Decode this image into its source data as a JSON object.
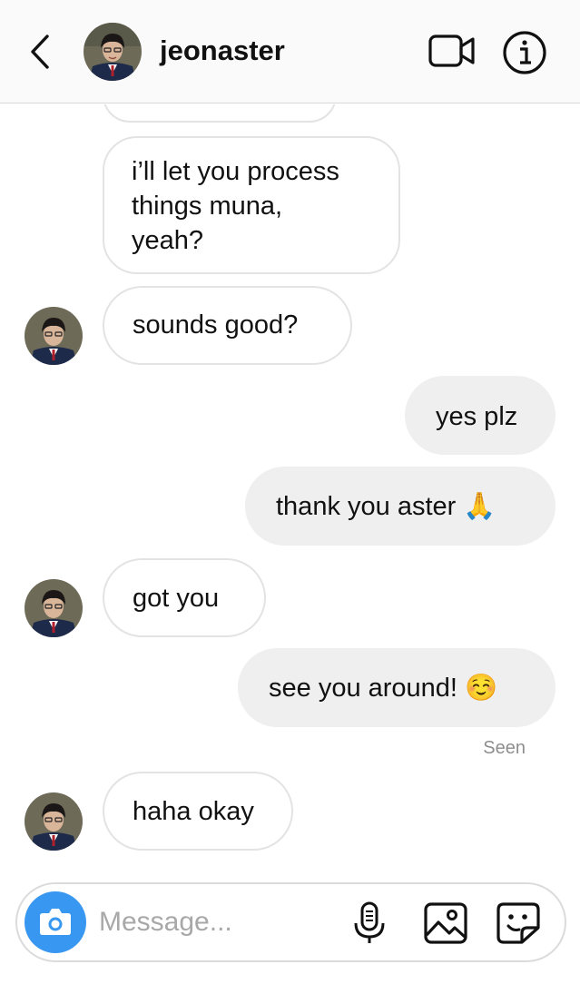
{
  "header": {
    "username": "jeonaster"
  },
  "composer": {
    "placeholder": "Message..."
  },
  "thread": {
    "messages": [
      {
        "from": "them",
        "text": ""
      },
      {
        "from": "them",
        "text": "i’ll let you process\nthings muna,\nyeah?"
      },
      {
        "from": "them",
        "text": "sounds good?"
      },
      {
        "from": "me",
        "text": "yes plz"
      },
      {
        "from": "me",
        "text": "thank you aster 🙏"
      },
      {
        "from": "them",
        "text": "got you"
      },
      {
        "from": "me",
        "text": "see you around! ☺️"
      },
      {
        "from": "them",
        "text": "haha okay"
      }
    ],
    "seen_label": "Seen"
  },
  "icons": {
    "back": "chevron-left-icon",
    "video": "video-camera-icon",
    "info": "info-icon",
    "camera": "camera-icon",
    "mic": "microphone-icon",
    "gallery": "image-gallery-icon",
    "sticker": "sticker-icon"
  },
  "colors": {
    "accent": "#3897f0",
    "bubble_out": "#efefef",
    "bubble_in_border": "#e3e3e3",
    "header_bg": "#fafafa",
    "seen_text": "#8e8e8e"
  }
}
